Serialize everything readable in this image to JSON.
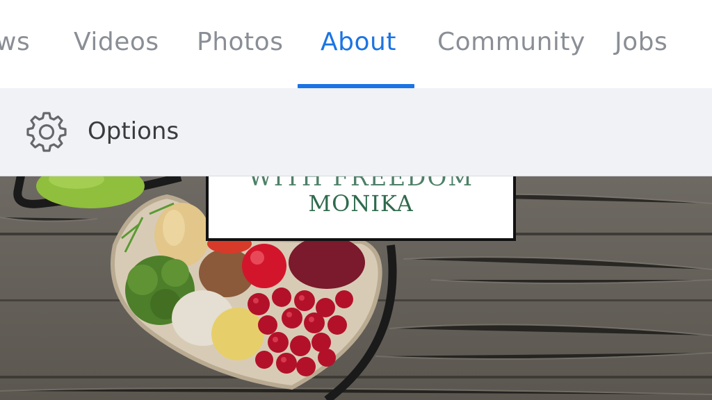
{
  "tabs": [
    {
      "label": "ws",
      "active": false
    },
    {
      "label": "Videos",
      "active": false
    },
    {
      "label": "Photos",
      "active": false
    },
    {
      "label": "About",
      "active": true
    },
    {
      "label": "Community",
      "active": false
    },
    {
      "label": "Jobs",
      "active": false
    }
  ],
  "options": {
    "label": "Options",
    "icon": "gear-icon"
  },
  "profile_card": {
    "line1": "WITH FREEDOM",
    "line2": "MONIKA"
  },
  "colors": {
    "accent": "#1b74e4",
    "tab_inactive": "#8a8e95",
    "options_bg": "#f0f2f5",
    "card_text": "#2f6a4d"
  }
}
